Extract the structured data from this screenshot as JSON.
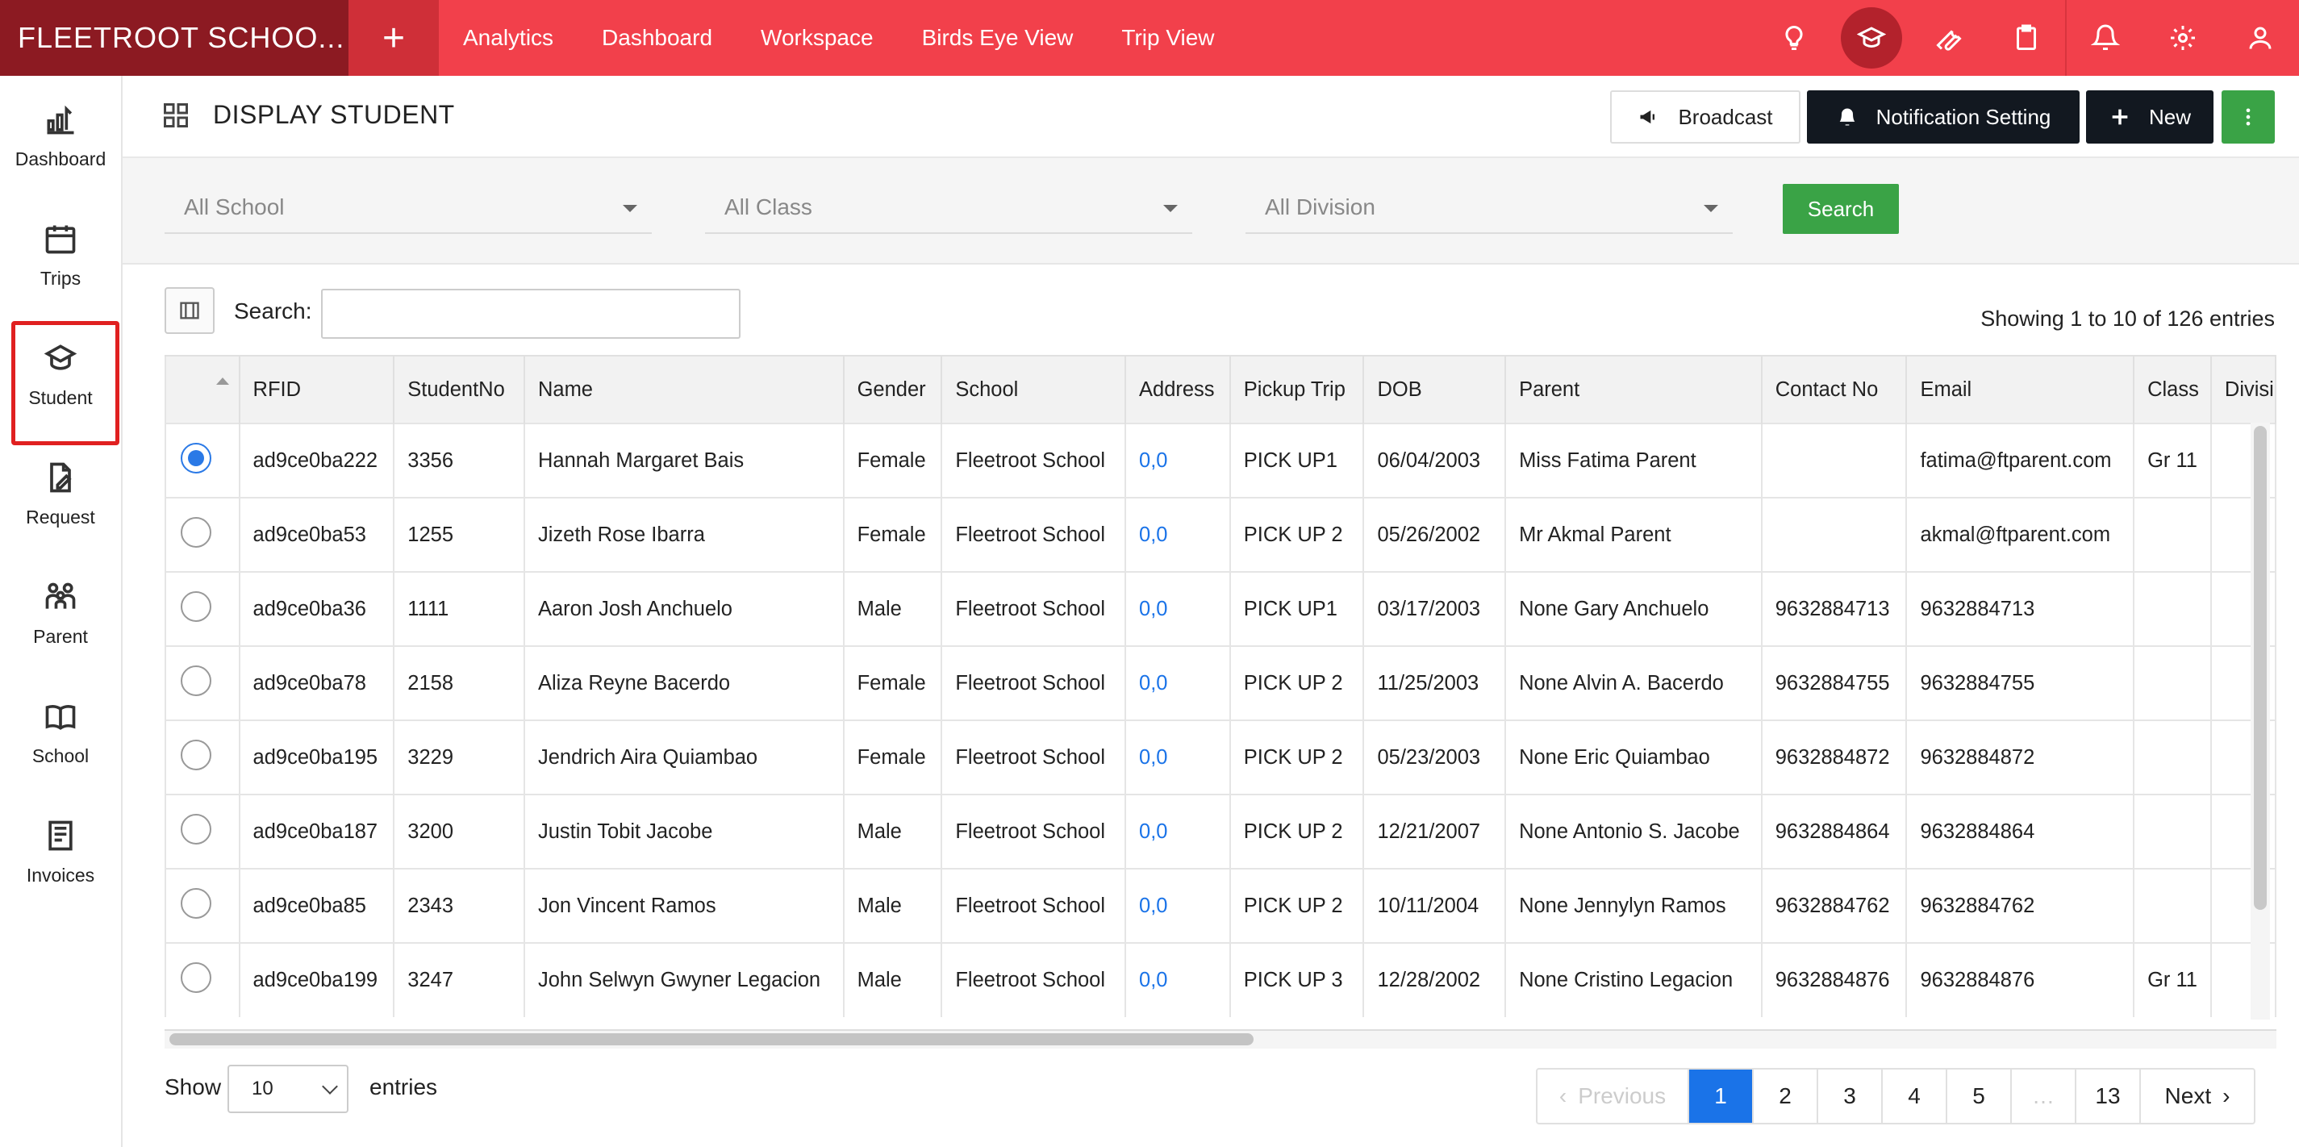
{
  "app": {
    "brand": "FLEETROOT SCHOO...",
    "add_symbol": "+"
  },
  "top_nav": [
    {
      "label": "Analytics"
    },
    {
      "label": "Dashboard"
    },
    {
      "label": "Workspace"
    },
    {
      "label": "Birds Eye View"
    },
    {
      "label": "Trip View"
    }
  ],
  "top_icons": [
    "lightbulb-icon",
    "graduation-cap-icon",
    "wrench-icon",
    "clipboard-icon",
    "bell-icon",
    "gear-icon",
    "user-icon"
  ],
  "sidebar": {
    "items": [
      {
        "label": "Dashboard",
        "icon": "chart-icon"
      },
      {
        "label": "Trips",
        "icon": "calendar-icon"
      },
      {
        "label": "Student",
        "icon": "student-cap-icon",
        "active": true
      },
      {
        "label": "Request",
        "icon": "edit-document-icon"
      },
      {
        "label": "Parent",
        "icon": "family-icon"
      },
      {
        "label": "School",
        "icon": "school-book-icon"
      },
      {
        "label": "Invoices",
        "icon": "invoice-icon"
      }
    ]
  },
  "header": {
    "title": "DISPLAY STUDENT",
    "broadcast_label": "Broadcast",
    "notification_label": "Notification Setting",
    "new_label": "New"
  },
  "filters": {
    "school": "All School",
    "class": "All Class",
    "division": "All Division",
    "search_label": "Search"
  },
  "table_toolbar": {
    "search_label": "Search:",
    "search_value": "",
    "showing": "Showing 1 to 10 of 126 entries"
  },
  "table": {
    "columns": [
      "",
      "RFID",
      "StudentNo",
      "Name",
      "Gender",
      "School",
      "Address",
      "Pickup Trip",
      "DOB",
      "Parent",
      "Contact No",
      "Email",
      "Class",
      "Divisi"
    ],
    "rows": [
      {
        "selected": true,
        "cells": [
          "ad9ce0ba222",
          "3356",
          "Hannah Margaret Bais",
          "Female",
          "Fleetroot School",
          "0,0",
          "PICK UP1",
          "06/04/2003",
          "Miss Fatima Parent",
          "",
          "fatima@ftparent.com",
          "Gr 11",
          ""
        ]
      },
      {
        "selected": false,
        "cells": [
          "ad9ce0ba53",
          "1255",
          "Jizeth Rose Ibarra",
          "Female",
          "Fleetroot School",
          "0,0",
          "PICK UP 2",
          "05/26/2002",
          "Mr Akmal Parent",
          "",
          "akmal@ftparent.com",
          "",
          ""
        ]
      },
      {
        "selected": false,
        "cells": [
          "ad9ce0ba36",
          "1111",
          "Aaron Josh Anchuelo",
          "Male",
          "Fleetroot School",
          "0,0",
          "PICK UP1",
          "03/17/2003",
          "None Gary Anchuelo",
          "9632884713",
          "9632884713",
          "",
          ""
        ]
      },
      {
        "selected": false,
        "cells": [
          "ad9ce0ba78",
          "2158",
          "Aliza Reyne Bacerdo",
          "Female",
          "Fleetroot School",
          "0,0",
          "PICK UP 2",
          "11/25/2003",
          "None Alvin A. Bacerdo",
          "9632884755",
          "9632884755",
          "",
          ""
        ]
      },
      {
        "selected": false,
        "cells": [
          "ad9ce0ba195",
          "3229",
          "Jendrich Aira Quiambao",
          "Female",
          "Fleetroot School",
          "0,0",
          "PICK UP 2",
          "05/23/2003",
          "None Eric Quiambao",
          "9632884872",
          "9632884872",
          "",
          ""
        ]
      },
      {
        "selected": false,
        "cells": [
          "ad9ce0ba187",
          "3200",
          "Justin Tobit Jacobe",
          "Male",
          "Fleetroot School",
          "0,0",
          "PICK UP 2",
          "12/21/2007",
          "None Antonio S. Jacobe",
          "9632884864",
          "9632884864",
          "",
          ""
        ]
      },
      {
        "selected": false,
        "cells": [
          "ad9ce0ba85",
          "2343",
          "Jon Vincent Ramos",
          "Male",
          "Fleetroot School",
          "0,0",
          "PICK UP 2",
          "10/11/2004",
          "None Jennylyn Ramos",
          "9632884762",
          "9632884762",
          "",
          ""
        ]
      },
      {
        "selected": false,
        "cells": [
          "ad9ce0ba199",
          "3247",
          "John Selwyn Gwyner Legacion",
          "Male",
          "Fleetroot School",
          "0,0",
          "PICK UP 3",
          "12/28/2002",
          "None Cristino Legacion",
          "9632884876",
          "9632884876",
          "Gr 11",
          ""
        ]
      }
    ]
  },
  "footer": {
    "show_label": "Show",
    "page_size": "10",
    "entries_label": "entries",
    "pagination": {
      "previous": "Previous",
      "pages": [
        "1",
        "2",
        "3",
        "4",
        "5",
        "…",
        "13"
      ],
      "current": "1",
      "next": "Next"
    }
  },
  "colors": {
    "topbar": "#f2404b",
    "brand_bg": "#8c1a22",
    "accent_blue": "#1a73e8",
    "green": "#3aa346",
    "dark": "#121820"
  }
}
